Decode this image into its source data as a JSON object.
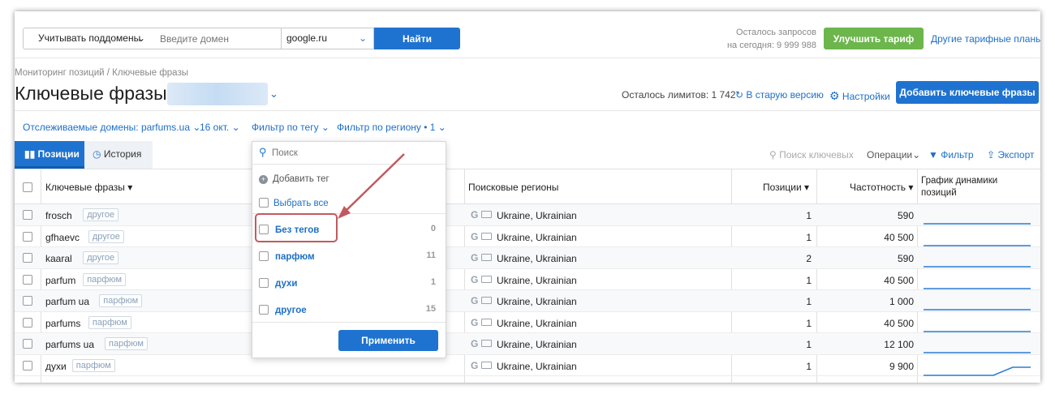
{
  "topbar": {
    "subdomains_label": "Учитывать поддомены",
    "domain_placeholder": "Введите домен",
    "search_engine": "google.ru",
    "find_label": "Найти",
    "quota_line1": "Осталось запросов",
    "quota_line2": "на сегодня: 9 999 988",
    "upgrade_label": "Улучшить тариф",
    "plans_label": "Другие тарифные планы"
  },
  "header": {
    "breadcrumb": "Мониторинг позиций / Ключевые фразы",
    "title": "Ключевые фразы",
    "limits": "Осталось лимитов: 1 742",
    "old_version": "В старую версию",
    "settings": "Настройки",
    "add_keywords": "Добавить ключевые фразы"
  },
  "filters": {
    "domains": "Отслеживаемые домены: parfums.ua",
    "date": "16 окт.",
    "tag_filter": "Фильтр по тегу",
    "region_filter": "Фильтр по региону • 1"
  },
  "tabs": {
    "positions": "Позиции",
    "history": "История"
  },
  "tools": {
    "search_placeholder": "Поиск ключевых",
    "operations": "Операции",
    "filter": "Фильтр",
    "export": "Экспорт"
  },
  "table": {
    "headers": {
      "keywords": "Ключевые фразы",
      "regions": "Поисковые регионы",
      "positions": "Позиции",
      "frequency": "Частотность",
      "chart_line1": "График динамики",
      "chart_line2": "позиций"
    },
    "rows": [
      {
        "keyword": "frosch",
        "tag": "другое",
        "region": "Ukraine, Ukrainian",
        "position": "1",
        "frequency": "590"
      },
      {
        "keyword": "gfhaevc",
        "tag": "другое",
        "region": "Ukraine, Ukrainian",
        "position": "1",
        "frequency": "40 500"
      },
      {
        "keyword": "kaaral",
        "tag": "другое",
        "region": "Ukraine, Ukrainian",
        "position": "2",
        "frequency": "590"
      },
      {
        "keyword": "parfum",
        "tag": "парфюм",
        "region": "Ukraine, Ukrainian",
        "position": "1",
        "frequency": "40 500"
      },
      {
        "keyword": "parfum ua",
        "tag": "парфюм",
        "region": "Ukraine, Ukrainian",
        "position": "1",
        "frequency": "1 000"
      },
      {
        "keyword": "parfums",
        "tag": "парфюм",
        "region": "Ukraine, Ukrainian",
        "position": "1",
        "frequency": "40 500"
      },
      {
        "keyword": "parfums ua",
        "tag": "парфюм",
        "region": "Ukraine, Ukrainian",
        "position": "1",
        "frequency": "12 100"
      },
      {
        "keyword": "духи",
        "tag": "парфюм",
        "region": "Ukraine, Ukrainian",
        "position": "1",
        "frequency": "9 900"
      }
    ]
  },
  "tag_dropdown": {
    "search_placeholder": "Поиск",
    "add_tag": "Добавить тег",
    "select_all": "Выбрать все",
    "items": [
      {
        "label": "Без тегов",
        "count": "0"
      },
      {
        "label": "парфюм",
        "count": "11"
      },
      {
        "label": "духи",
        "count": "1"
      },
      {
        "label": "другое",
        "count": "15"
      }
    ],
    "apply": "Применить"
  },
  "colors": {
    "accent": "#1f73d0",
    "green": "#6cb64c",
    "highlight": "#c15a5f"
  }
}
